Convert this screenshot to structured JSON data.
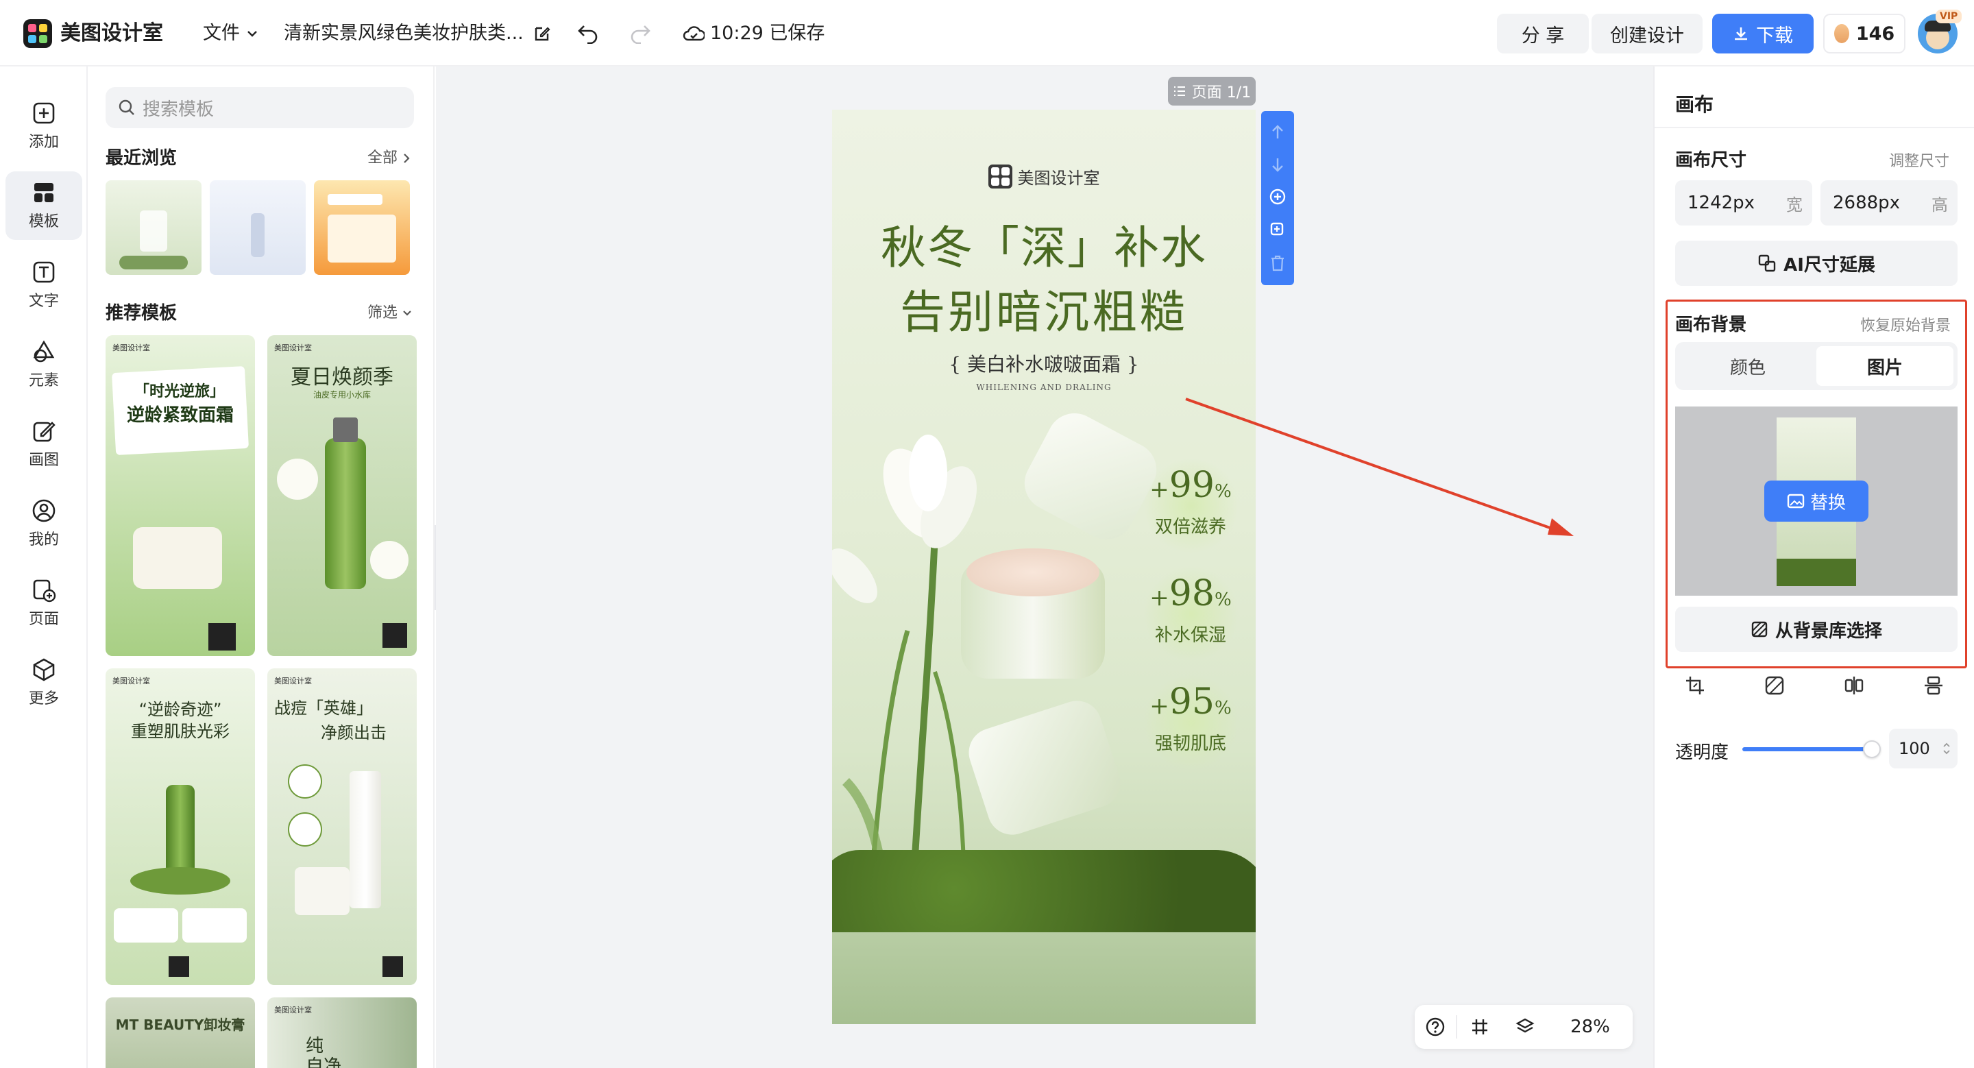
{
  "app": {
    "name": "美图设计室"
  },
  "topbar": {
    "file_menu": "文件",
    "doc_title": "清新实景风绿色美妆护肤类...",
    "save_status": "10:29 已保存",
    "share": "分 享",
    "create": "创建设计",
    "download": "下载",
    "coins": "146",
    "vip_badge": "VIP"
  },
  "rail": [
    {
      "label": "添加",
      "icon": "plus-square-icon"
    },
    {
      "label": "模板",
      "icon": "template-grid-icon",
      "active": true
    },
    {
      "label": "文字",
      "icon": "text-box-icon"
    },
    {
      "label": "元素",
      "icon": "shapes-icon"
    },
    {
      "label": "画图",
      "icon": "pencil-box-icon"
    },
    {
      "label": "我的",
      "icon": "user-circle-icon"
    },
    {
      "label": "页面",
      "icon": "page-add-icon"
    },
    {
      "label": "更多",
      "icon": "cube-icon"
    }
  ],
  "templates": {
    "search_placeholder": "搜索模板",
    "recent_title": "最近浏览",
    "recent_link": "全部",
    "recommended_title": "推荐模板",
    "recommended_link": "筛选",
    "cards": [
      {
        "title": "「时光逆旅」",
        "subtitle": "逆龄紧致面霜",
        "brand": "美图设计室"
      },
      {
        "title": "夏日焕颜季",
        "subtitle": "油皮专用小水库",
        "brand": "美图设计室"
      },
      {
        "title": "“逆龄奇迹”",
        "subtitle": "重塑肌肤光彩",
        "brand": "美图设计室"
      },
      {
        "title": "战痘「英雄」",
        "subtitle": "净颜出击",
        "brand": "美图设计室"
      },
      {
        "title": "MT BEAUTY卸妆膏",
        "subtitle": "",
        "brand": ""
      },
      {
        "title": "纯",
        "subtitle": "自净",
        "brand": "美图设计室"
      }
    ]
  },
  "canvas": {
    "page_indicator": "页面 1/1",
    "brand": "美图设计室",
    "headline1": "秋冬「深」补水",
    "headline2": "告别暗沉粗糙",
    "product": "{ 美白补水啵啵面霜 }",
    "product_en": "WHILENING AND DRALING",
    "stats": [
      {
        "prefix": "+",
        "num": "99",
        "unit": "%",
        "label": "双倍滋养"
      },
      {
        "prefix": "+",
        "num": "98",
        "unit": "%",
        "label": "补水保湿"
      },
      {
        "prefix": "+",
        "num": "95",
        "unit": "%",
        "label": "强韧肌底"
      }
    ],
    "zoom": "28%"
  },
  "right_panel": {
    "title": "画布",
    "size_title": "画布尺寸",
    "size_link": "调整尺寸",
    "width_value": "1242px",
    "width_suffix": "宽",
    "height_value": "2688px",
    "height_suffix": "高",
    "ai_extend": "AI尺寸延展",
    "bg_title": "画布背景",
    "bg_reset": "恢复原始背景",
    "tab_color": "颜色",
    "tab_image": "图片",
    "replace": "替换",
    "from_library": "从背景库选择",
    "opacity_label": "透明度",
    "opacity_value": "100"
  },
  "colors": {
    "accent": "#3f7ef8",
    "highlight": "#e0412b",
    "poster_green": "#4a6a22"
  }
}
